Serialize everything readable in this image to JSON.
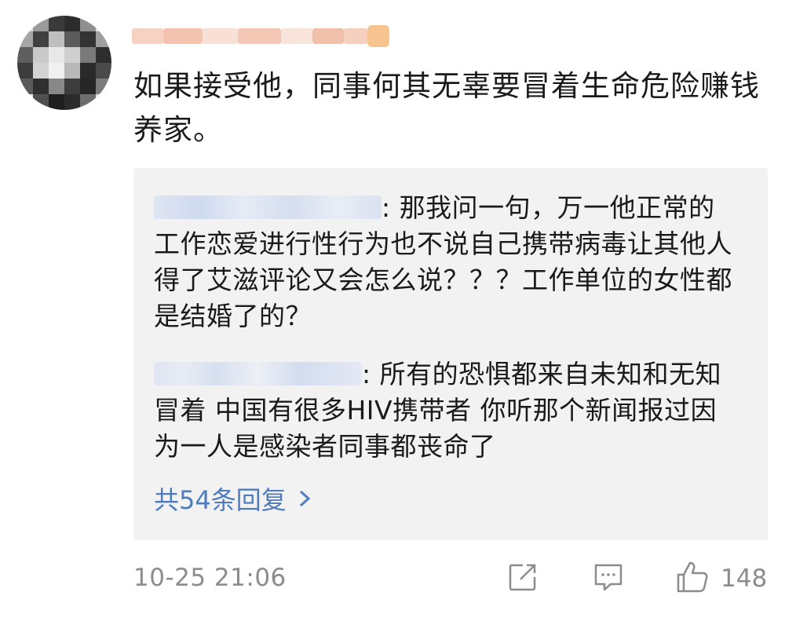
{
  "comment": {
    "text": "如果接受他，同事何其无辜要冒着生命危险赚钱养家。",
    "timestamp": "10-25 21:06",
    "like_count": "148"
  },
  "replies": [
    {
      "text": ": 那我问一句，万一他正常的工作恋爱进行性行为也不说自己携带病毒让其他人得了艾滋评论又会怎么说？？？工作单位的女性都是结婚了的？"
    },
    {
      "text": ": 所有的恐惧都来自未知和无知冒着 中国有很多HIV携带者 你听那个新闻报过因为一人是感染者同事都丧命了"
    }
  ],
  "more_replies_label": "共54条回复",
  "icons": {
    "share": "share-icon",
    "comment": "comment-icon",
    "like": "thumbs-up-icon",
    "chevron": "chevron-right-icon"
  },
  "colors": {
    "link": "#4f7cbe",
    "meta": "#8c8c8c",
    "reply_bg": "#f2f2f2"
  }
}
